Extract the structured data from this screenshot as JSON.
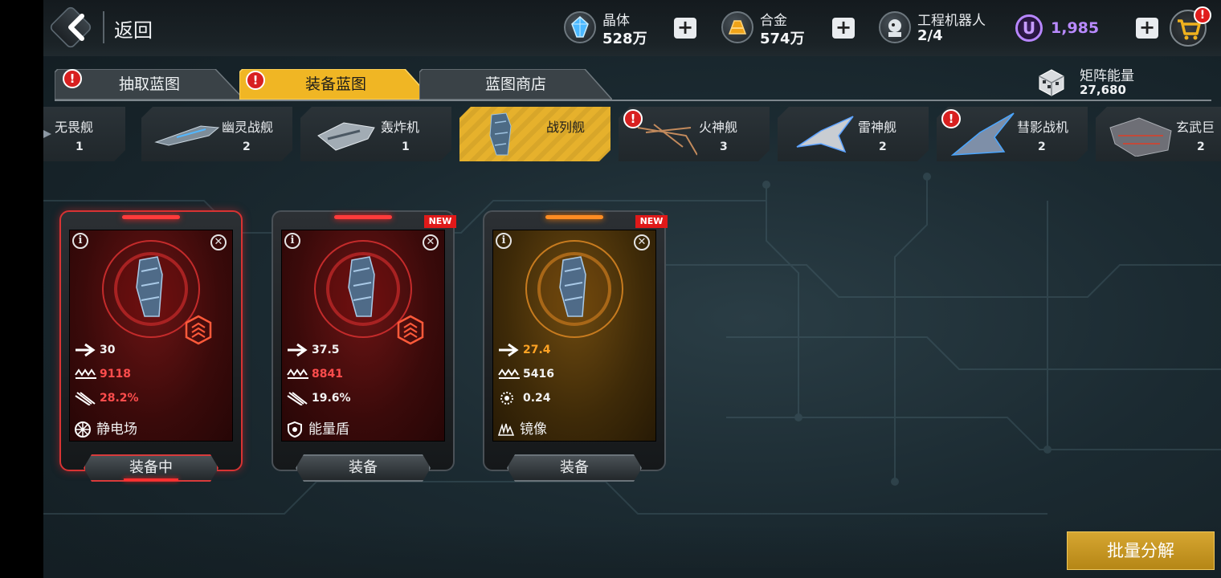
{
  "header": {
    "back_label": "返回",
    "resources": [
      {
        "label": "晶体",
        "value": "528万",
        "icon": "crystal-icon"
      },
      {
        "label": "合金",
        "value": "574万",
        "icon": "alloy-icon"
      },
      {
        "label": "工程机器人",
        "value": "2/4",
        "icon": "robot-icon"
      }
    ],
    "premium_currency": {
      "symbol": "U",
      "value": "1,985"
    },
    "cart_badge": "!"
  },
  "tabs": [
    {
      "label": "抽取蓝图",
      "alert": "!"
    },
    {
      "label": "装备蓝图",
      "alert": "!"
    },
    {
      "label": "蓝图商店"
    }
  ],
  "matrix_energy": {
    "label": "矩阵能量",
    "value": "27,680"
  },
  "ship_categories": [
    {
      "name": "无畏舰",
      "count": "1"
    },
    {
      "name": "幽灵战舰",
      "count": "2"
    },
    {
      "name": "轰炸机",
      "count": "1"
    },
    {
      "name": "战列舰",
      "count": ""
    },
    {
      "name": "火神舰",
      "count": "3",
      "alert": "!"
    },
    {
      "name": "雷神舰",
      "count": "2"
    },
    {
      "name": "彗影战机",
      "count": "2",
      "alert": "!"
    },
    {
      "name": "玄武巨",
      "count": "2"
    }
  ],
  "blueprints": [
    {
      "speed": "30",
      "armor": "9118",
      "crit": "28.2%",
      "skill": "静电场",
      "button": "装备中",
      "new": "",
      "info": "i",
      "close": "✕"
    },
    {
      "speed": "37.5",
      "armor": "8841",
      "crit": "19.6%",
      "skill": "能量盾",
      "button": "装备",
      "new": "NEW",
      "info": "i",
      "close": "✕"
    },
    {
      "speed": "27.4",
      "armor": "5416",
      "crit": "0.24",
      "skill": "镜像",
      "button": "装备",
      "new": "NEW",
      "info": "i",
      "close": "✕"
    }
  ],
  "batch_button": "批量分解",
  "colors": {
    "accent_gold": "#e6b12c",
    "alert_red": "#e01919",
    "premium_purple": "#b98aff"
  }
}
